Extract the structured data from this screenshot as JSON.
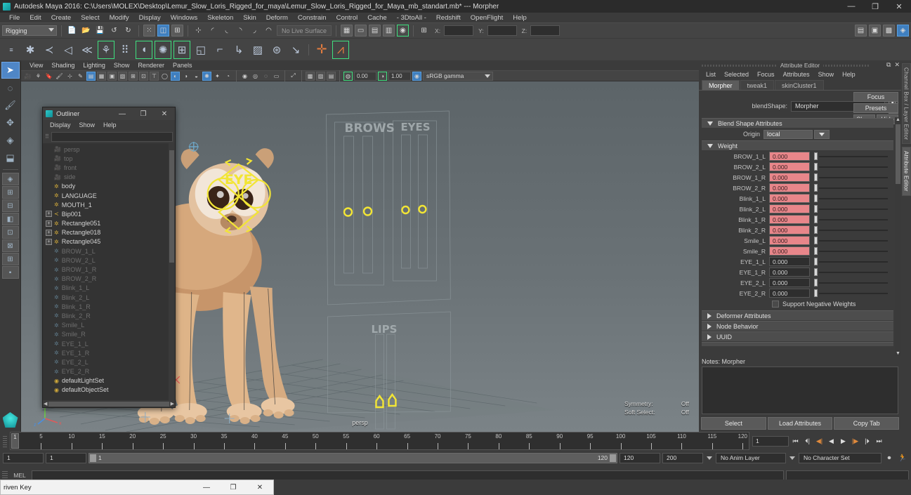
{
  "window": {
    "title": "Autodesk Maya 2016: C:\\Users\\MOLEX\\Desktop\\Lemur_Slow_Loris_Rigged_for_maya\\Lemur_Slow_Loris_Rigged_for_Maya_mb_standart.mb*  ---  Morpher",
    "minimize": "—",
    "maximize": "❐",
    "close": "✕",
    "app_icon": "maya-icon"
  },
  "menubar": [
    "File",
    "Edit",
    "Create",
    "Select",
    "Modify",
    "Display",
    "Windows",
    "Skeleton",
    "Skin",
    "Deform",
    "Constrain",
    "Control",
    "Cache",
    "- 3DtoAll -",
    "Redshift",
    "OpenFlight",
    "Help"
  ],
  "statusline": {
    "mode": "Rigging",
    "live_surface": "No Live Surface",
    "coord_labels": [
      "X:",
      "Y:",
      "Z:"
    ],
    "coord_values": [
      "",
      "",
      ""
    ]
  },
  "viewport_panel": {
    "menus": [
      "View",
      "Shading",
      "Lighting",
      "Show",
      "Renderer",
      "Panels"
    ],
    "exposure": "0.00",
    "gamma": "1.00",
    "color_profile": "sRGB gamma",
    "camera_label": "persp",
    "hud": [
      {
        "label": "Symmetry:",
        "value": "Off"
      },
      {
        "label": "Soft Select:",
        "value": "Off"
      }
    ],
    "scene_labels": [
      "BROWS",
      "EYES",
      "LIPS",
      "EYE"
    ],
    "axis": {
      "x": "x",
      "y": "y",
      "z": "z"
    }
  },
  "outliner": {
    "title": "Outliner",
    "minimize": "—",
    "maximize": "❐",
    "close": "✕",
    "menus": [
      "Display",
      "Show",
      "Help"
    ],
    "search_value": "",
    "items": [
      {
        "label": "persp",
        "icon": "camera-icon",
        "dim": true,
        "expandable": false
      },
      {
        "label": "top",
        "icon": "camera-icon",
        "dim": true,
        "expandable": false
      },
      {
        "label": "front",
        "icon": "camera-icon",
        "dim": true,
        "expandable": false
      },
      {
        "label": "side",
        "icon": "camera-icon",
        "dim": true,
        "expandable": false
      },
      {
        "label": "body",
        "icon": "transform-icon",
        "dim": false,
        "expandable": false
      },
      {
        "label": "LANGUAGE",
        "icon": "transform-icon",
        "dim": false,
        "expandable": false
      },
      {
        "label": "MOUTH_1",
        "icon": "transform-icon",
        "dim": false,
        "expandable": false
      },
      {
        "label": "Bip001",
        "icon": "joint-icon",
        "dim": false,
        "expandable": true
      },
      {
        "label": "Rectangle051",
        "icon": "transform-icon",
        "dim": false,
        "expandable": true
      },
      {
        "label": "Rectangle018",
        "icon": "transform-icon",
        "dim": false,
        "expandable": true
      },
      {
        "label": "Rectangle045",
        "icon": "transform-icon",
        "dim": false,
        "expandable": true
      },
      {
        "label": "BROW_1_L",
        "icon": "transform-icon",
        "dim": true,
        "expandable": false
      },
      {
        "label": "BROW_2_L",
        "icon": "transform-icon",
        "dim": true,
        "expandable": false
      },
      {
        "label": "BROW_1_R",
        "icon": "transform-icon",
        "dim": true,
        "expandable": false
      },
      {
        "label": "BROW_2_R",
        "icon": "transform-icon",
        "dim": true,
        "expandable": false
      },
      {
        "label": "Blink_1_L",
        "icon": "transform-icon",
        "dim": true,
        "expandable": false
      },
      {
        "label": "Blink_2_L",
        "icon": "transform-icon",
        "dim": true,
        "expandable": false
      },
      {
        "label": "Blink_1_R",
        "icon": "transform-icon",
        "dim": true,
        "expandable": false
      },
      {
        "label": "Blink_2_R",
        "icon": "transform-icon",
        "dim": true,
        "expandable": false
      },
      {
        "label": "Smile_L",
        "icon": "transform-icon",
        "dim": true,
        "expandable": false
      },
      {
        "label": "Smile_R",
        "icon": "transform-icon",
        "dim": true,
        "expandable": false
      },
      {
        "label": "EYE_1_L",
        "icon": "transform-icon",
        "dim": true,
        "expandable": false
      },
      {
        "label": "EYE_1_R",
        "icon": "transform-icon",
        "dim": true,
        "expandable": false
      },
      {
        "label": "EYE_2_L",
        "icon": "transform-icon",
        "dim": true,
        "expandable": false
      },
      {
        "label": "EYE_2_R",
        "icon": "transform-icon",
        "dim": true,
        "expandable": false
      },
      {
        "label": "defaultLightSet",
        "icon": "set-icon",
        "dim": false,
        "expandable": false
      },
      {
        "label": "defaultObjectSet",
        "icon": "set-icon",
        "dim": false,
        "expandable": false
      }
    ]
  },
  "attribute_editor": {
    "title": "Attribute Editor",
    "menus": [
      "List",
      "Selected",
      "Focus",
      "Attributes",
      "Show",
      "Help"
    ],
    "tabs": [
      {
        "label": "Morpher",
        "selected": true
      },
      {
        "label": "tweak1",
        "selected": false
      },
      {
        "label": "skinCluster1",
        "selected": false
      }
    ],
    "blendshape_label": "blendShape:",
    "blendshape_value": "Morpher",
    "side_buttons": {
      "focus": "Focus",
      "presets": "Presets",
      "show": "Show",
      "hide": "Hide"
    },
    "sections": {
      "blend_shape_attributes": "Blend Shape Attributes",
      "weight": "Weight",
      "deformer_attributes": "Deformer Attributes",
      "node_behavior": "Node Behavior",
      "uuid": "UUID"
    },
    "origin_label": "Origin",
    "origin_value": "local",
    "weights": [
      {
        "name": "BROW_1_L",
        "value": "0.000",
        "highlight": true
      },
      {
        "name": "BROW_2_L",
        "value": "0.000",
        "highlight": true
      },
      {
        "name": "BROW_1_R",
        "value": "0.000",
        "highlight": true
      },
      {
        "name": "BROW_2_R",
        "value": "0.000",
        "highlight": true
      },
      {
        "name": "Blink_1_L",
        "value": "0.000",
        "highlight": true
      },
      {
        "name": "Blink_2_L",
        "value": "0.000",
        "highlight": true
      },
      {
        "name": "Blink_1_R",
        "value": "0.000",
        "highlight": true
      },
      {
        "name": "Blink_2_R",
        "value": "0.000",
        "highlight": true
      },
      {
        "name": "Smile_L",
        "value": "0.000",
        "highlight": true
      },
      {
        "name": "Smile_R",
        "value": "0.000",
        "highlight": true
      },
      {
        "name": "EYE_1_L",
        "value": "0.000",
        "highlight": false
      },
      {
        "name": "EYE_1_R",
        "value": "0.000",
        "highlight": false
      },
      {
        "name": "EYE_2_L",
        "value": "0.000",
        "highlight": false
      },
      {
        "name": "EYE_2_R",
        "value": "0.000",
        "highlight": false
      }
    ],
    "support_negative_weights": "Support Negative Weights",
    "notes_label": "Notes:  Morpher",
    "notes_value": "",
    "buttons": [
      "Select",
      "Load Attributes",
      "Copy Tab"
    ],
    "highlight_color": "#e8868a"
  },
  "dock_tabs": [
    {
      "label": "Channel Box / Layer Editor",
      "selected": false
    },
    {
      "label": "Attribute Editor",
      "selected": true
    }
  ],
  "timeline": {
    "ticks": [
      5,
      10,
      15,
      20,
      25,
      30,
      35,
      40,
      45,
      50,
      55,
      60,
      65,
      70,
      75,
      80,
      85,
      90,
      95,
      100,
      105,
      110,
      115,
      120
    ],
    "current_frame": "1",
    "current_frame_field": "1",
    "range_start": "1",
    "range_end": "1",
    "range_bar_start": "1",
    "range_bar_end": "120",
    "playback_end": "120",
    "anim_end": "200",
    "anim_layer": "No Anim Layer",
    "character_set": "No Character Set",
    "transport": [
      "⏮",
      "⏪",
      "◀|",
      "◀",
      "▶",
      "|▶",
      "⏩",
      "⏭"
    ]
  },
  "command_line": {
    "label": "MEL",
    "input_value": "",
    "output_value": ""
  },
  "driven_key_window": {
    "title": "riven Key",
    "minimize": "—",
    "maximize": "❐",
    "close": "✕"
  }
}
